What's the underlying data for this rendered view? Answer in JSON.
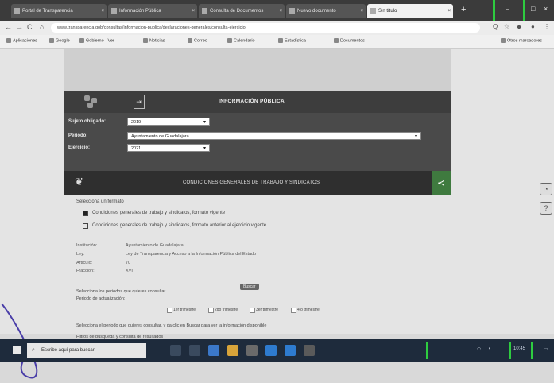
{
  "browser": {
    "tabs": [
      {
        "label": "Portal de Transparencia",
        "active": false
      },
      {
        "label": "Información Pública",
        "active": false
      },
      {
        "label": "Consulta de Documentos",
        "active": false
      },
      {
        "label": "Nuevo documento",
        "active": false
      },
      {
        "label": "Sin título",
        "active": true
      }
    ],
    "url": "www.transparencia.gob/consultas/informacion-publica/declaraciones-generales/consulta-ejercicio",
    "bookmarks": [
      "Aplicaciones",
      "Google",
      "Gobierno - Ver",
      "Noticias",
      "Correo",
      "Calendario",
      "Estadística",
      "Documentos",
      "Otros marcadores"
    ]
  },
  "header": {
    "title": "INFORMACIÓN PÚBLICA"
  },
  "form": {
    "fields": [
      {
        "label": "Sujeto obligado:",
        "value": "2019"
      },
      {
        "label": "Periodo:",
        "value": "Ayuntamiento de Guadalajara"
      },
      {
        "label": "Ejercicio:",
        "value": "2021"
      }
    ]
  },
  "section": {
    "title": "CONDICIONES GENERALES DE TRABAJO Y SINDICATOS"
  },
  "content": {
    "intro": "Selecciona un formato",
    "option_1": "Condiciones generales de trabajo y sindicatos, formato vigente",
    "option_2": "Condiciones generales de trabajo y sindicatos, formato anterior al ejercicio vigente",
    "details": [
      {
        "label": "Institución:",
        "value": "Ayuntamiento de Guadalajara"
      },
      {
        "label": "Ley:",
        "value": "Ley de Transparencia y Acceso a la Información Pública del Estado"
      },
      {
        "label": "Artículo:",
        "value": "70"
      },
      {
        "label": "Fracción:",
        "value": "XVI"
      }
    ],
    "filter_title": "Selecciona los periodos que quieres consultar",
    "filter_sub": "Periodo de actualización:",
    "checks": [
      "1er trimestre",
      "2do trimestre",
      "3er trimestre",
      "4to trimestre"
    ],
    "note_1": "Selecciona el periodo que quieres consultar, y da clic en Buscar para ver la información disponible",
    "note_2": "Filtros de búsqueda y consulta de resultados"
  },
  "tooltip": "Buscar",
  "taskbar": {
    "search_placeholder": "Escribe aquí para buscar",
    "time": "10:45"
  }
}
